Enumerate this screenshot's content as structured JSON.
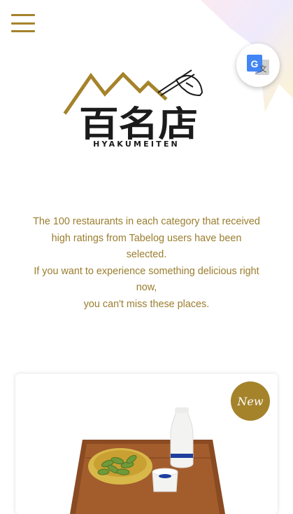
{
  "header": {
    "menu_icon": "hamburger-menu-icon",
    "translate_icon": "google-translate-icon"
  },
  "logo": {
    "kanji": "百名店",
    "wordmark": "HYAKUMEITEN"
  },
  "intro": {
    "lines": [
      "The 100 restaurants in each category that received",
      "high ratings from Tabelog users have been",
      "selected.",
      "If you want to experience something delicious right",
      "now,",
      "you can't miss these places."
    ]
  },
  "card": {
    "badge": "New"
  },
  "colors": {
    "accent": "#a5832b",
    "intro_text": "#9a7d2e"
  }
}
